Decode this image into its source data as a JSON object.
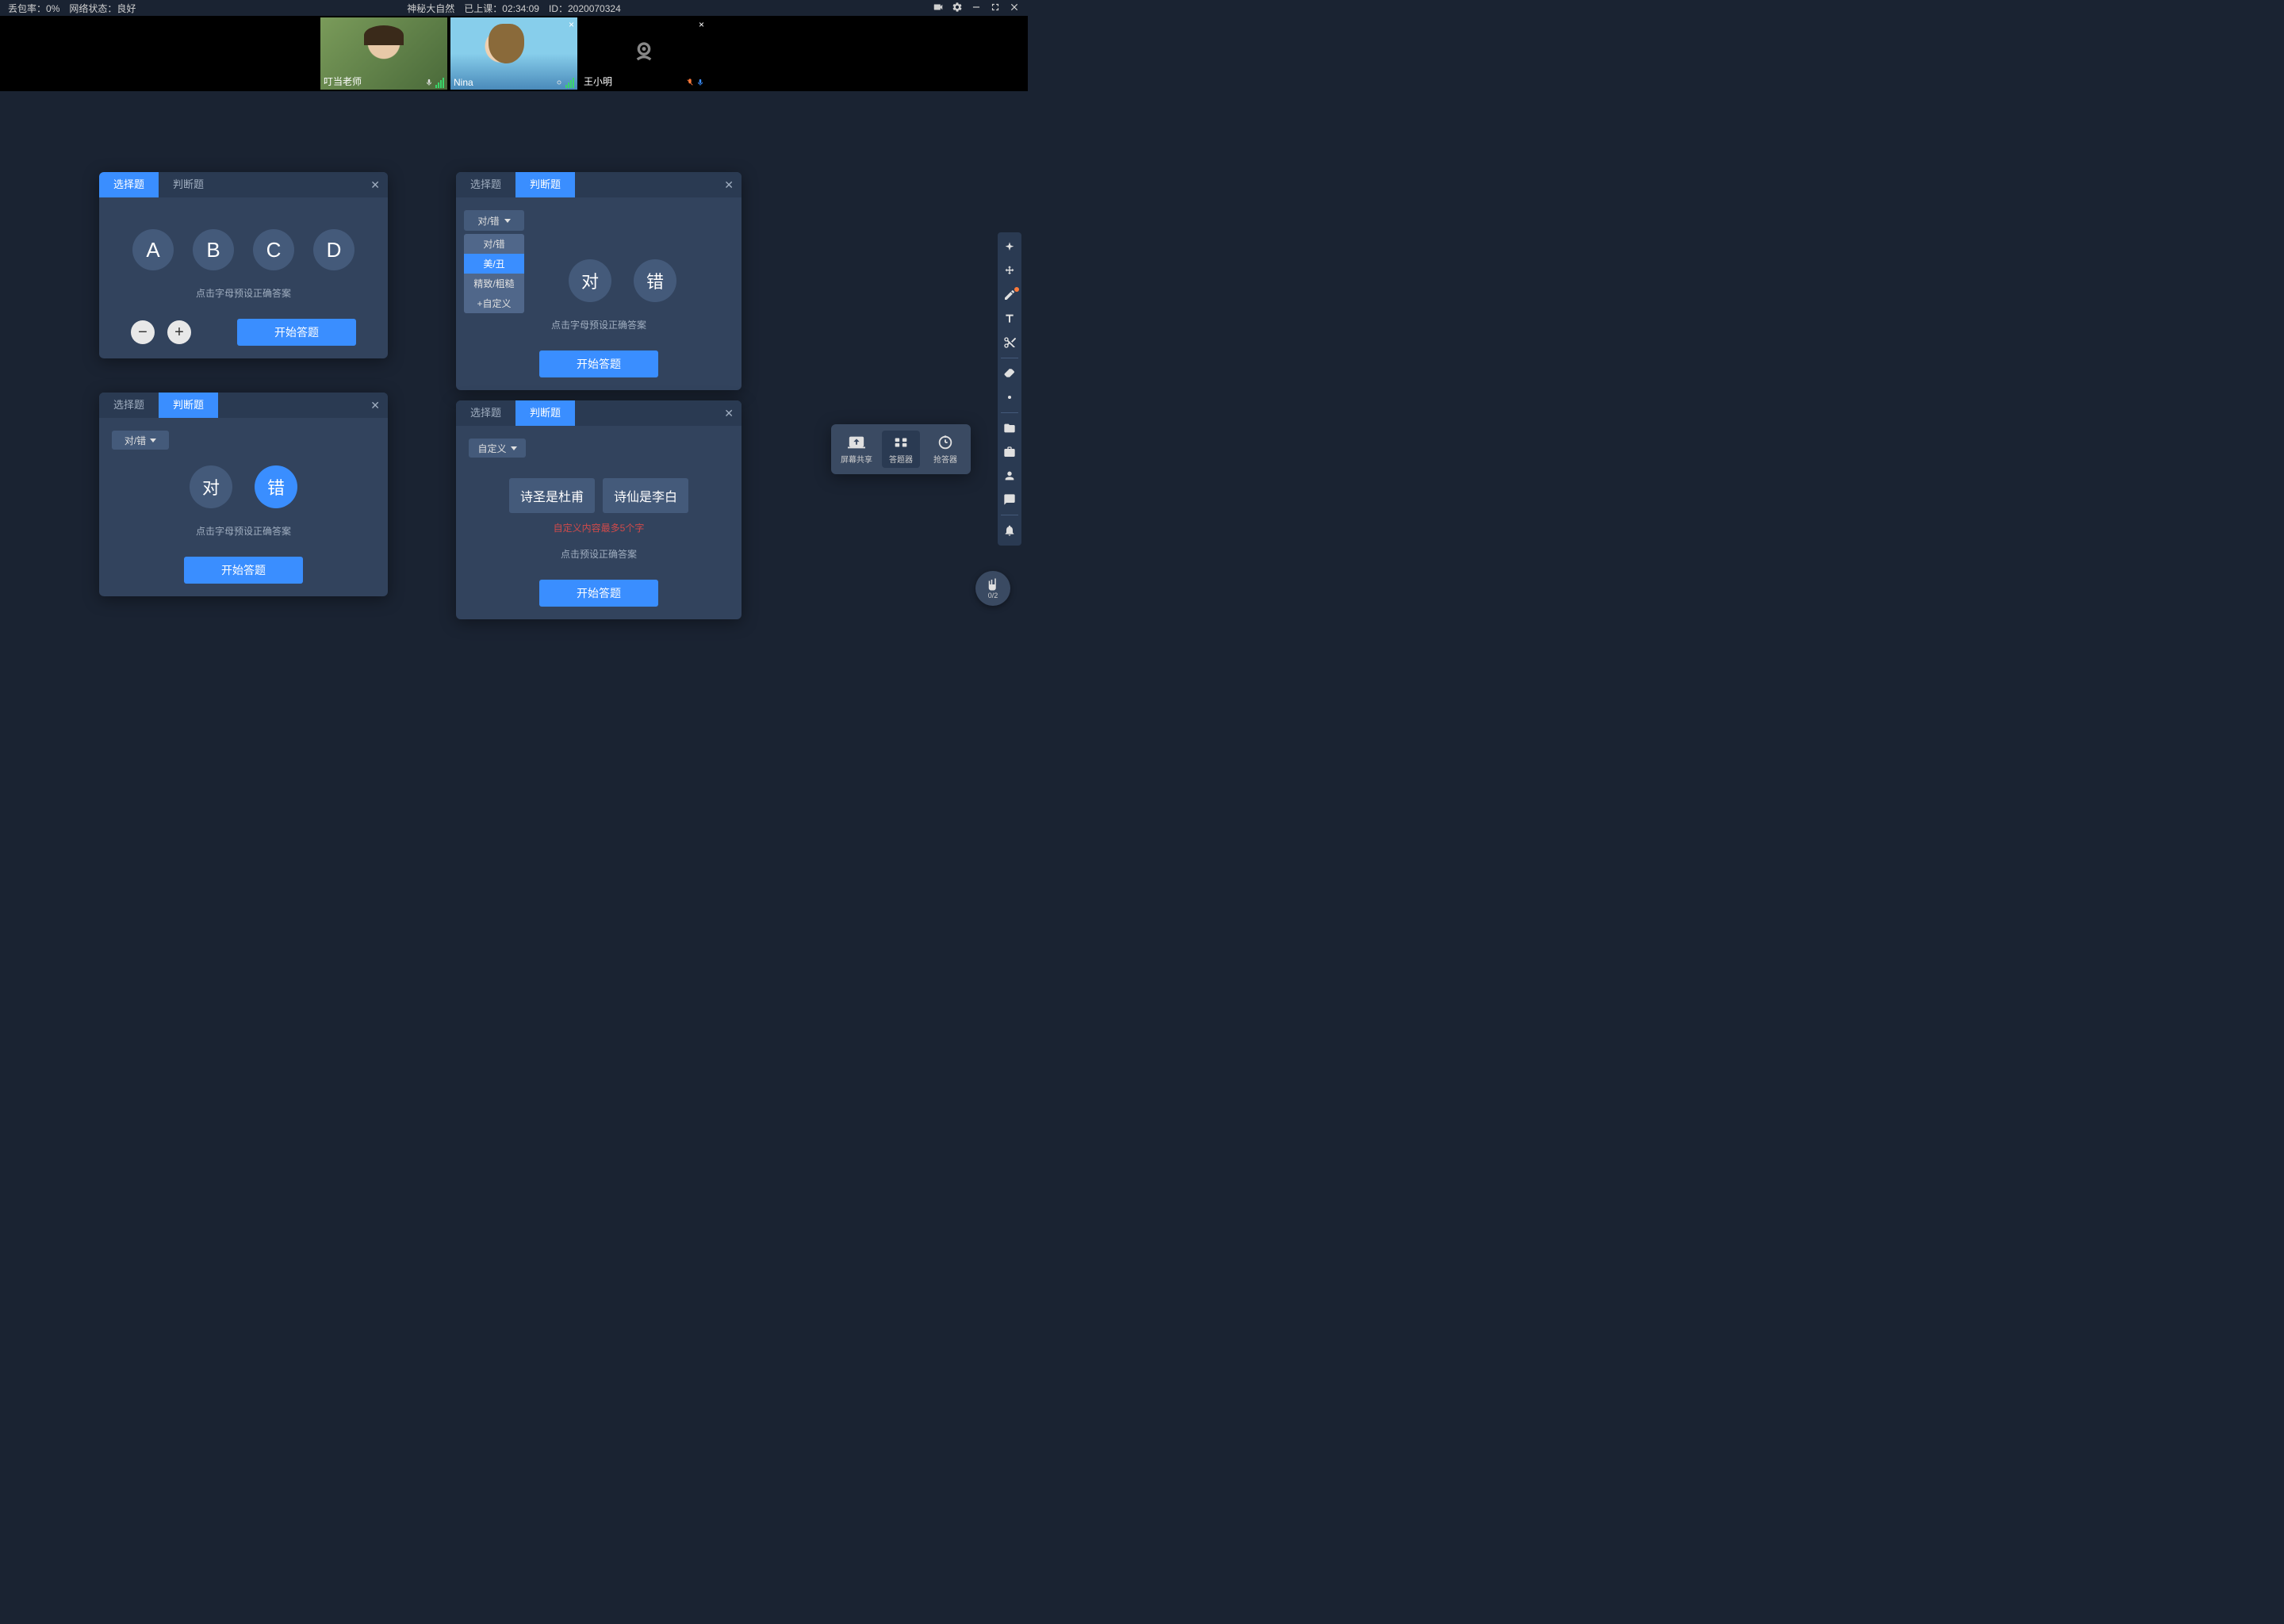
{
  "topbar": {
    "packet_loss_label": "丢包率：",
    "packet_loss_value": "0%",
    "network_label": "网络状态：",
    "network_value": "良好",
    "course_title": "神秘大自然",
    "class_time_label": "已上课：",
    "class_time_value": "02:34:09",
    "id_label": "ID：",
    "id_value": "2020070324"
  },
  "participants": [
    {
      "name": "叮当老师",
      "camera": true
    },
    {
      "name": "Nina",
      "camera": true
    },
    {
      "name": "王小明",
      "camera": false
    }
  ],
  "tabs": {
    "choice": "选择题",
    "judge": "判断题"
  },
  "panel1": {
    "letters": [
      "A",
      "B",
      "C",
      "D"
    ],
    "hint": "点击字母预设正确答案",
    "start": "开始答题"
  },
  "panel2": {
    "dropdown_label": "对/错",
    "options": [
      "对/错",
      "美/丑",
      "精致/粗糙",
      "+自定义"
    ],
    "true_label": "对",
    "false_label": "错",
    "hint": "点击字母预设正确答案",
    "start": "开始答题"
  },
  "panel3": {
    "dropdown_label": "对/错",
    "true_label": "对",
    "false_label": "错",
    "hint": "点击字母预设正确答案",
    "start": "开始答题"
  },
  "panel4": {
    "dropdown_label": "自定义",
    "chip1": "诗圣是杜甫",
    "chip2": "诗仙是李白",
    "warn": "自定义内容最多5个字",
    "hint": "点击预设正确答案",
    "start": "开始答题"
  },
  "bottom_toolbar": {
    "share": "屏幕共享",
    "answer": "答题器",
    "responder": "抢答器"
  },
  "hand": {
    "count": "0/2"
  }
}
